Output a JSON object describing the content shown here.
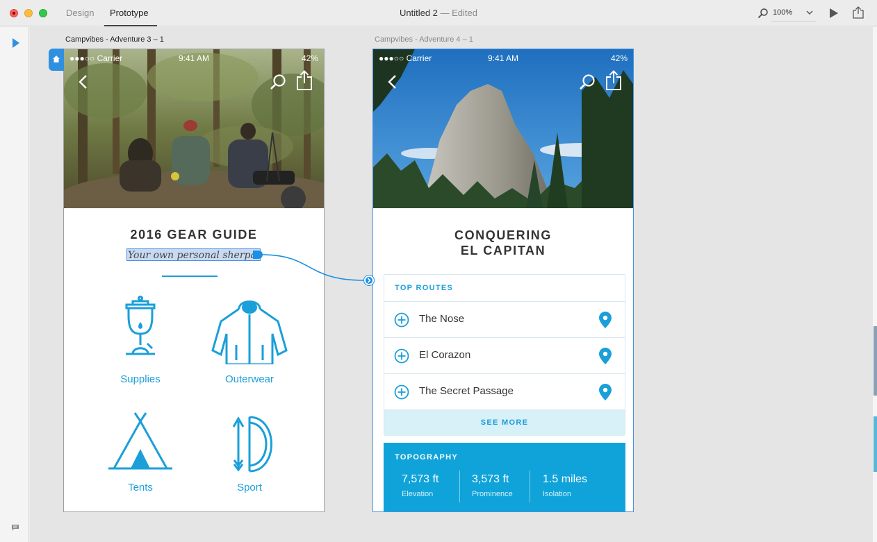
{
  "window": {
    "tabs": [
      {
        "label": "Design"
      },
      {
        "label": "Prototype"
      }
    ],
    "title": "Untitled 2",
    "title_status": " — Edited",
    "zoom": "100%"
  },
  "artboards": [
    {
      "label": "Campvibes - Adventure 3 – 1",
      "status": {
        "carrier": "●●●○○ Carrier",
        "time": "9:41 AM",
        "battery": "42%"
      },
      "title": "2016 GEAR GUIDE",
      "subtitle": "Your own personal sherpa.",
      "categories": [
        {
          "label": "Supplies",
          "icon": "lantern-icon"
        },
        {
          "label": "Outerwear",
          "icon": "jacket-icon"
        },
        {
          "label": "Tents",
          "icon": "tent-icon"
        },
        {
          "label": "Sport",
          "icon": "bow-and-arrow-icon"
        }
      ]
    },
    {
      "label": "Campvibes - Adventure 4 – 1",
      "status": {
        "carrier": "●●●○○ Carrier",
        "time": "9:41 AM",
        "battery": "42%"
      },
      "title_line1": "CONQUERING",
      "title_line2": "EL CAPITAN",
      "routes_header": "TOP ROUTES",
      "routes": [
        {
          "name": "The Nose"
        },
        {
          "name": "El Corazon"
        },
        {
          "name": "The Secret Passage"
        }
      ],
      "see_more": "SEE MORE",
      "topography": {
        "header": "TOPOGRAPHY",
        "stats": [
          {
            "value": "7,573 ft",
            "label": "Elevation"
          },
          {
            "value": "3,573 ft",
            "label": "Prominence"
          },
          {
            "value": "1.5 miles",
            "label": "Isolation"
          }
        ]
      }
    }
  ],
  "colors": {
    "accent": "#1a9fd9",
    "selection": "#4a90e2",
    "topography_bg": "#0fa3d9"
  }
}
